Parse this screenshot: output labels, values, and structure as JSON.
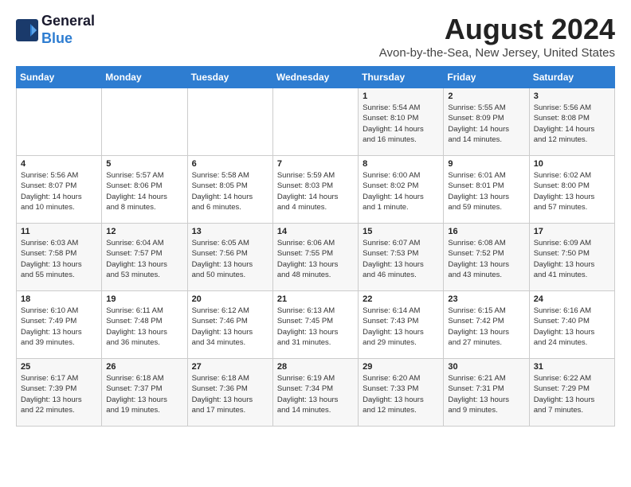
{
  "header": {
    "logo_line1": "General",
    "logo_line2": "Blue",
    "month_year": "August 2024",
    "location": "Avon-by-the-Sea, New Jersey, United States"
  },
  "days_of_week": [
    "Sunday",
    "Monday",
    "Tuesday",
    "Wednesday",
    "Thursday",
    "Friday",
    "Saturday"
  ],
  "weeks": [
    [
      {
        "day": "",
        "info": ""
      },
      {
        "day": "",
        "info": ""
      },
      {
        "day": "",
        "info": ""
      },
      {
        "day": "",
        "info": ""
      },
      {
        "day": "1",
        "info": "Sunrise: 5:54 AM\nSunset: 8:10 PM\nDaylight: 14 hours\nand 16 minutes."
      },
      {
        "day": "2",
        "info": "Sunrise: 5:55 AM\nSunset: 8:09 PM\nDaylight: 14 hours\nand 14 minutes."
      },
      {
        "day": "3",
        "info": "Sunrise: 5:56 AM\nSunset: 8:08 PM\nDaylight: 14 hours\nand 12 minutes."
      }
    ],
    [
      {
        "day": "4",
        "info": "Sunrise: 5:56 AM\nSunset: 8:07 PM\nDaylight: 14 hours\nand 10 minutes."
      },
      {
        "day": "5",
        "info": "Sunrise: 5:57 AM\nSunset: 8:06 PM\nDaylight: 14 hours\nand 8 minutes."
      },
      {
        "day": "6",
        "info": "Sunrise: 5:58 AM\nSunset: 8:05 PM\nDaylight: 14 hours\nand 6 minutes."
      },
      {
        "day": "7",
        "info": "Sunrise: 5:59 AM\nSunset: 8:03 PM\nDaylight: 14 hours\nand 4 minutes."
      },
      {
        "day": "8",
        "info": "Sunrise: 6:00 AM\nSunset: 8:02 PM\nDaylight: 14 hours\nand 1 minute."
      },
      {
        "day": "9",
        "info": "Sunrise: 6:01 AM\nSunset: 8:01 PM\nDaylight: 13 hours\nand 59 minutes."
      },
      {
        "day": "10",
        "info": "Sunrise: 6:02 AM\nSunset: 8:00 PM\nDaylight: 13 hours\nand 57 minutes."
      }
    ],
    [
      {
        "day": "11",
        "info": "Sunrise: 6:03 AM\nSunset: 7:58 PM\nDaylight: 13 hours\nand 55 minutes."
      },
      {
        "day": "12",
        "info": "Sunrise: 6:04 AM\nSunset: 7:57 PM\nDaylight: 13 hours\nand 53 minutes."
      },
      {
        "day": "13",
        "info": "Sunrise: 6:05 AM\nSunset: 7:56 PM\nDaylight: 13 hours\nand 50 minutes."
      },
      {
        "day": "14",
        "info": "Sunrise: 6:06 AM\nSunset: 7:55 PM\nDaylight: 13 hours\nand 48 minutes."
      },
      {
        "day": "15",
        "info": "Sunrise: 6:07 AM\nSunset: 7:53 PM\nDaylight: 13 hours\nand 46 minutes."
      },
      {
        "day": "16",
        "info": "Sunrise: 6:08 AM\nSunset: 7:52 PM\nDaylight: 13 hours\nand 43 minutes."
      },
      {
        "day": "17",
        "info": "Sunrise: 6:09 AM\nSunset: 7:50 PM\nDaylight: 13 hours\nand 41 minutes."
      }
    ],
    [
      {
        "day": "18",
        "info": "Sunrise: 6:10 AM\nSunset: 7:49 PM\nDaylight: 13 hours\nand 39 minutes."
      },
      {
        "day": "19",
        "info": "Sunrise: 6:11 AM\nSunset: 7:48 PM\nDaylight: 13 hours\nand 36 minutes."
      },
      {
        "day": "20",
        "info": "Sunrise: 6:12 AM\nSunset: 7:46 PM\nDaylight: 13 hours\nand 34 minutes."
      },
      {
        "day": "21",
        "info": "Sunrise: 6:13 AM\nSunset: 7:45 PM\nDaylight: 13 hours\nand 31 minutes."
      },
      {
        "day": "22",
        "info": "Sunrise: 6:14 AM\nSunset: 7:43 PM\nDaylight: 13 hours\nand 29 minutes."
      },
      {
        "day": "23",
        "info": "Sunrise: 6:15 AM\nSunset: 7:42 PM\nDaylight: 13 hours\nand 27 minutes."
      },
      {
        "day": "24",
        "info": "Sunrise: 6:16 AM\nSunset: 7:40 PM\nDaylight: 13 hours\nand 24 minutes."
      }
    ],
    [
      {
        "day": "25",
        "info": "Sunrise: 6:17 AM\nSunset: 7:39 PM\nDaylight: 13 hours\nand 22 minutes."
      },
      {
        "day": "26",
        "info": "Sunrise: 6:18 AM\nSunset: 7:37 PM\nDaylight: 13 hours\nand 19 minutes."
      },
      {
        "day": "27",
        "info": "Sunrise: 6:18 AM\nSunset: 7:36 PM\nDaylight: 13 hours\nand 17 minutes."
      },
      {
        "day": "28",
        "info": "Sunrise: 6:19 AM\nSunset: 7:34 PM\nDaylight: 13 hours\nand 14 minutes."
      },
      {
        "day": "29",
        "info": "Sunrise: 6:20 AM\nSunset: 7:33 PM\nDaylight: 13 hours\nand 12 minutes."
      },
      {
        "day": "30",
        "info": "Sunrise: 6:21 AM\nSunset: 7:31 PM\nDaylight: 13 hours\nand 9 minutes."
      },
      {
        "day": "31",
        "info": "Sunrise: 6:22 AM\nSunset: 7:29 PM\nDaylight: 13 hours\nand 7 minutes."
      }
    ]
  ]
}
